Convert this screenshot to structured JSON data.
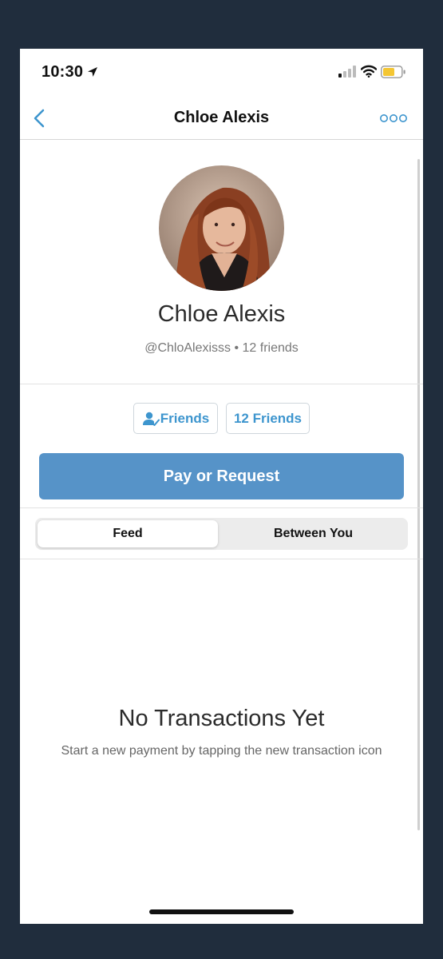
{
  "status": {
    "time": "10:30"
  },
  "nav": {
    "title": "Chloe Alexis"
  },
  "profile": {
    "name": "Chloe Alexis",
    "subtitle": "@ChloAlexisss • 12 friends"
  },
  "actions": {
    "friends_label": "Friends",
    "friends_count_label": "12 Friends",
    "pay_label": "Pay or Request"
  },
  "tabs": [
    {
      "label": "Feed",
      "selected": true
    },
    {
      "label": "Between You",
      "selected": false
    }
  ],
  "empty_state": {
    "title": "No Transactions Yet",
    "message": "Start a new payment by tapping the new transaction icon"
  },
  "colors": {
    "accent": "#3d95ce",
    "pay_button": "#5693c8",
    "background": "#202d3d"
  }
}
